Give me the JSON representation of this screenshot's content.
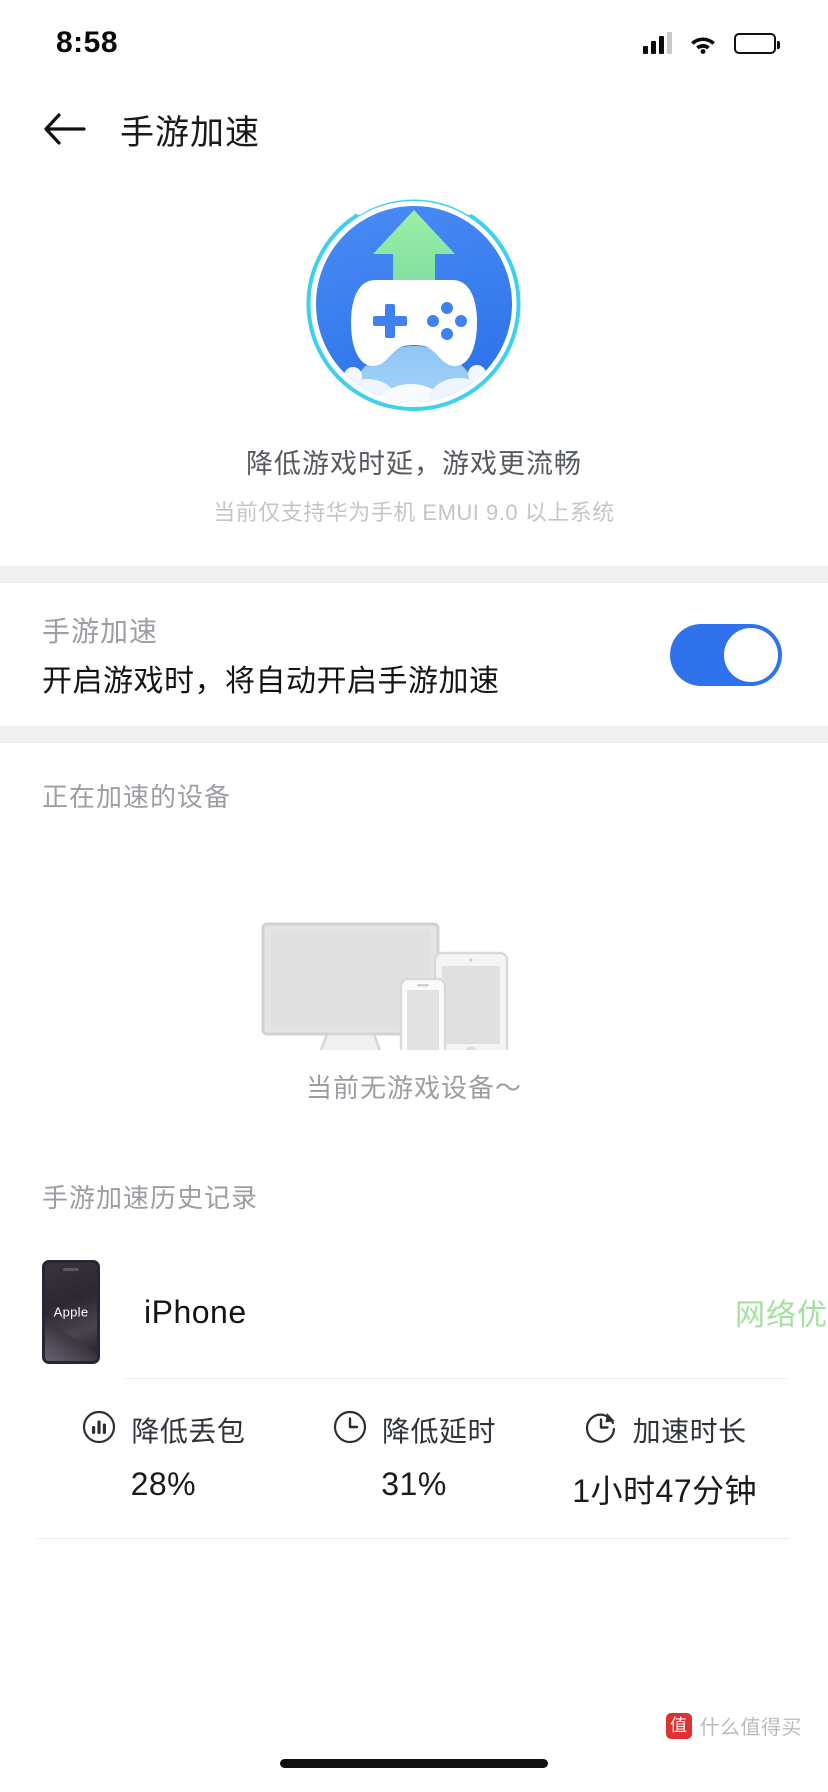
{
  "status_bar": {
    "time": "8:58",
    "signal_icon": "signal-bars-icon",
    "wifi_icon": "wifi-icon",
    "battery_icon": "battery-icon"
  },
  "nav": {
    "back_icon": "back-arrow-icon",
    "title": "手游加速"
  },
  "hero": {
    "illustration": "game-boost-gamepad-icon",
    "caption": "降低游戏时延，游戏更流畅",
    "subcaption": "当前仅支持华为手机 EMUI 9.0 以上系统"
  },
  "toggle_section": {
    "title": "手游加速",
    "description": "开启游戏时，将自动开启手游加速",
    "switch_on": true,
    "switch_color": "#2f72eb"
  },
  "devices_section": {
    "label": "正在加速的设备",
    "empty_illustration": "devices-monitor-tablet-phone-icon",
    "empty_text": "当前无游戏设备～"
  },
  "history_section": {
    "label": "手游加速历史记录",
    "record": {
      "thumbnail_brand": "Apple",
      "device_name": "iPhone",
      "status": "网络优",
      "status_color": "#a6e0a0",
      "stats": [
        {
          "icon": "packet-loss-icon",
          "label": "降低丢包",
          "value": "28%"
        },
        {
          "icon": "clock-icon",
          "label": "降低延时",
          "value": "31%"
        },
        {
          "icon": "duration-icon",
          "label": "加速时长",
          "value": "1小时47分钟"
        }
      ]
    }
  },
  "watermark": {
    "badge": "值",
    "text": "什么值得买"
  },
  "colors": {
    "accent_blue": "#2f72eb",
    "hero_circle": "#3d82f0",
    "hero_ring": "#35cdeb",
    "arrow_green": "#8fe39a",
    "band_gray": "#f0f0f0",
    "muted_text": "#9b9ea3"
  }
}
